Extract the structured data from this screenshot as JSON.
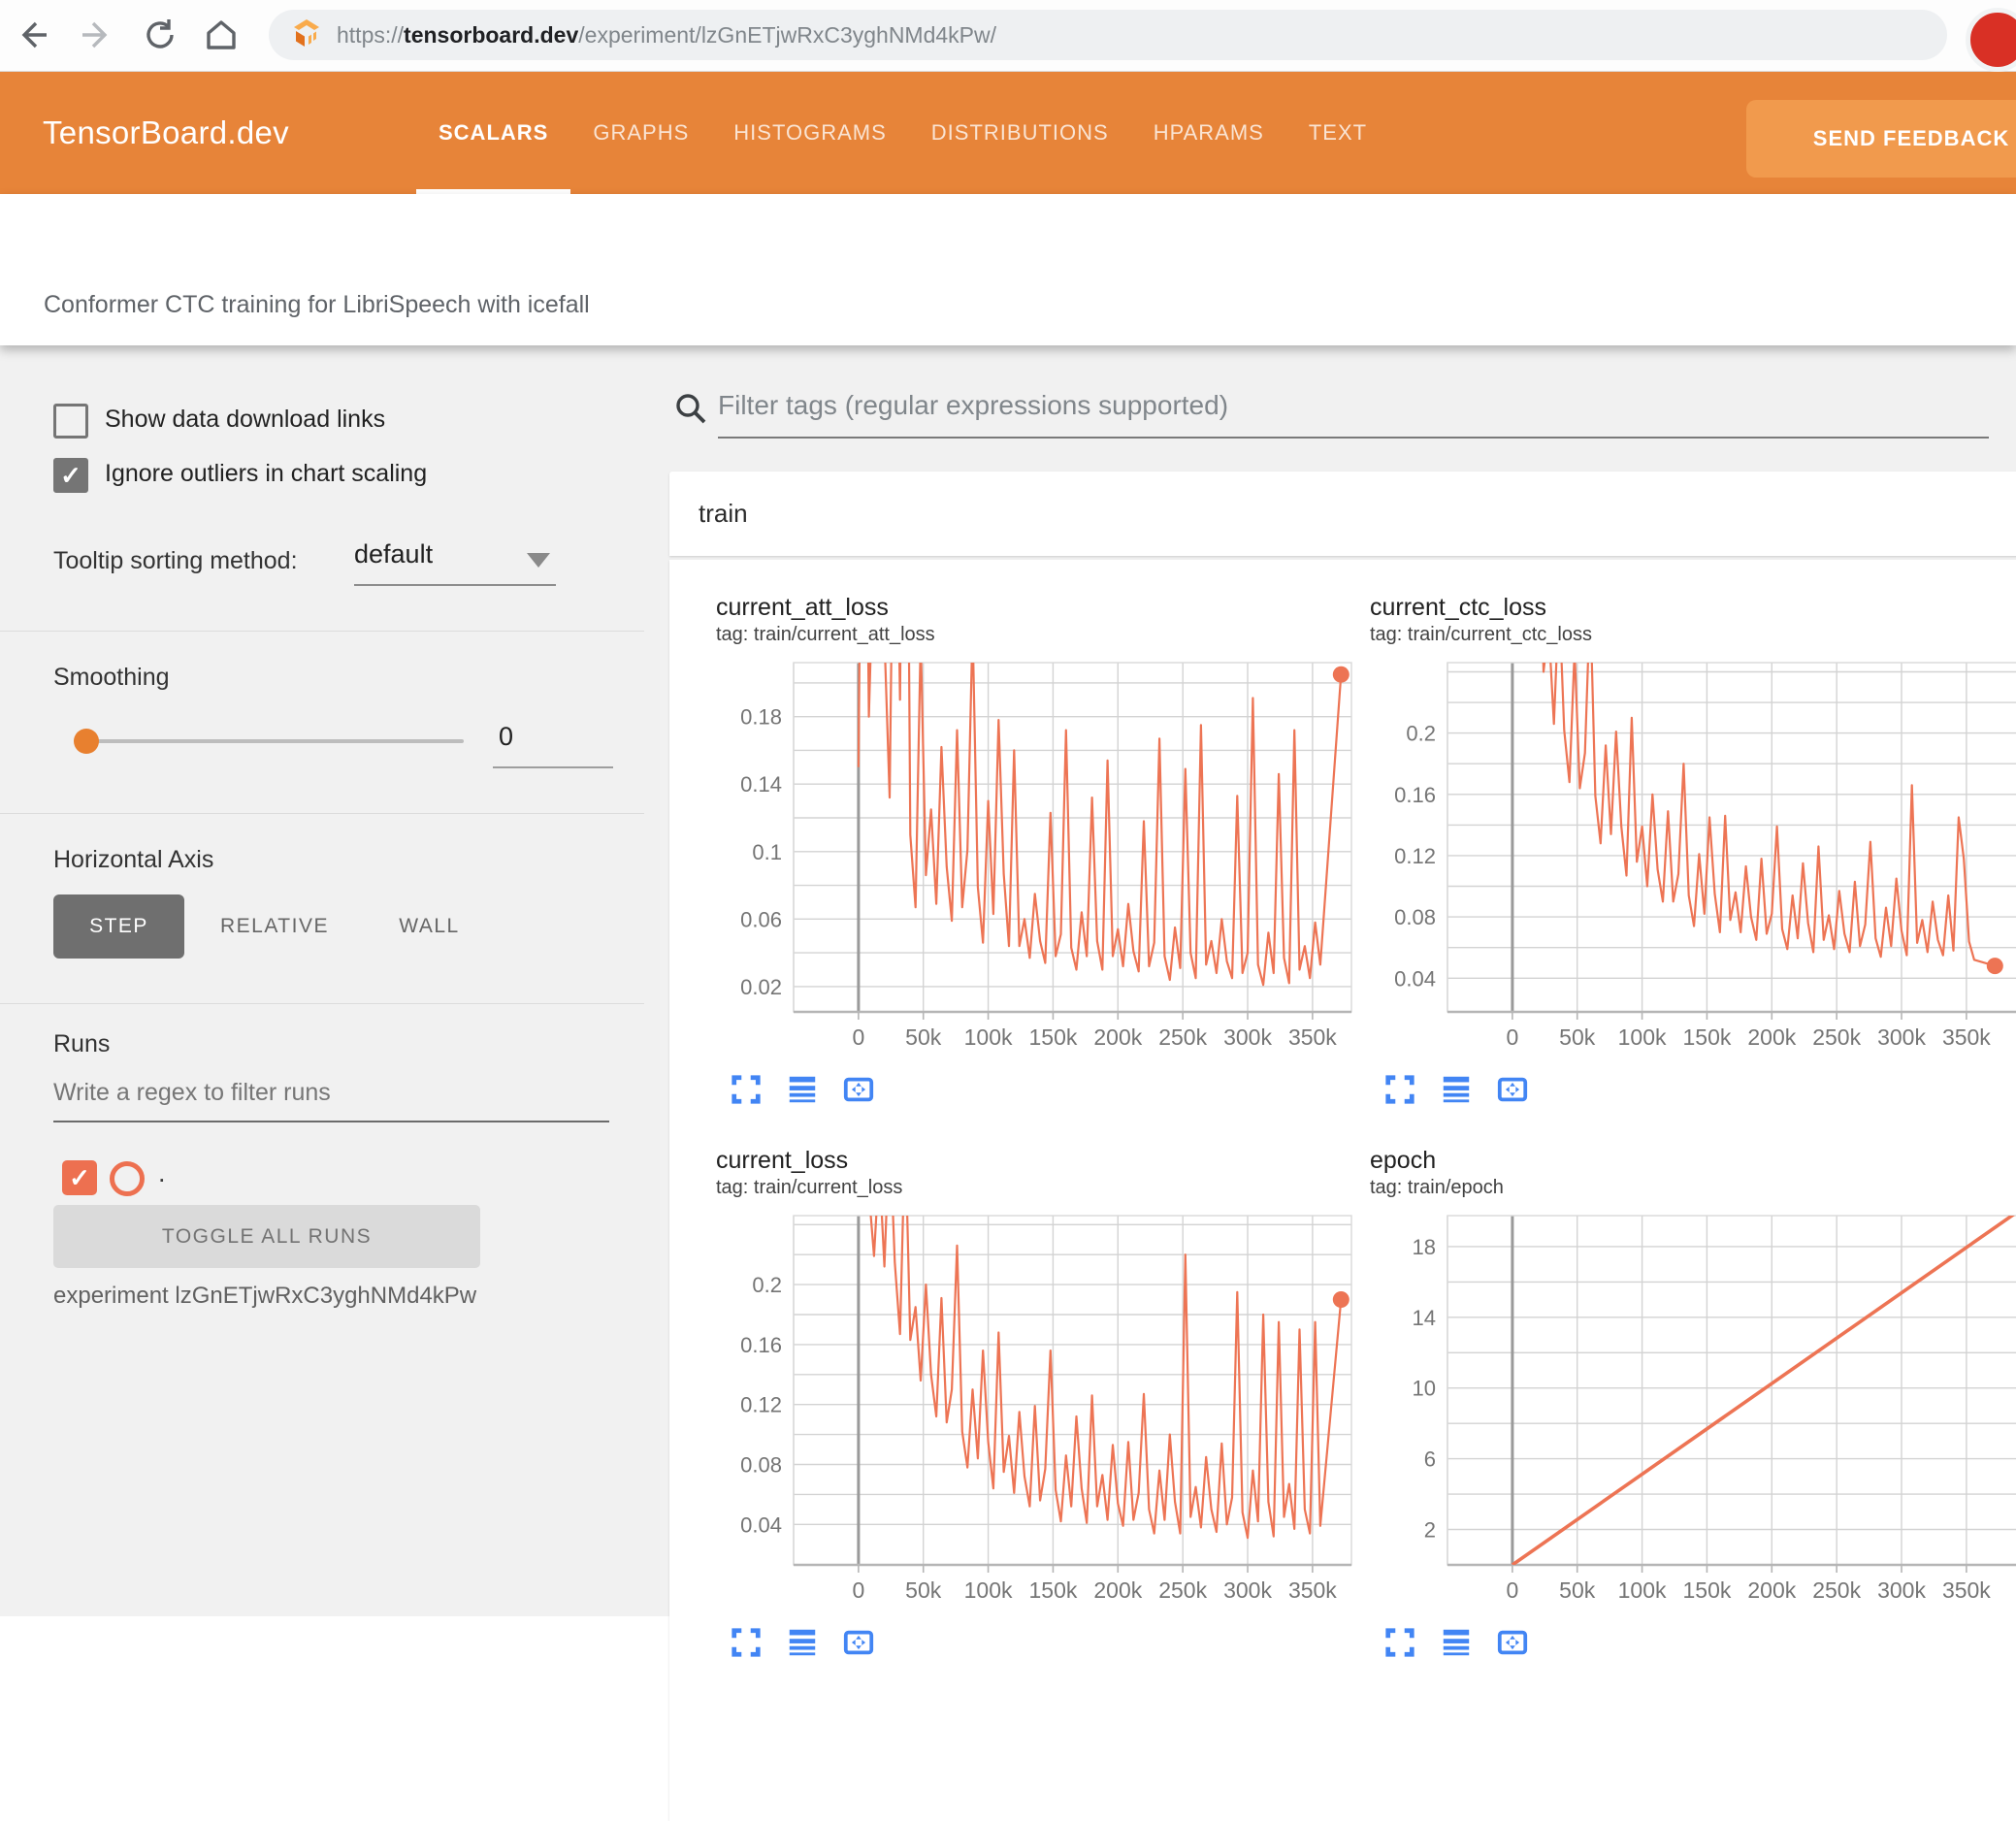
{
  "browser": {
    "url_scheme": "https://",
    "url_domain": "tensorboard.dev",
    "url_path": "/experiment/lzGnETjwRxC3yghNMd4kPw/"
  },
  "header": {
    "brand": "TensorBoard.dev",
    "tabs": [
      {
        "label": "SCALARS",
        "active": true
      },
      {
        "label": "GRAPHS",
        "active": false
      },
      {
        "label": "HISTOGRAMS",
        "active": false
      },
      {
        "label": "DISTRIBUTIONS",
        "active": false
      },
      {
        "label": "HPARAMS",
        "active": false
      },
      {
        "label": "TEXT",
        "active": false
      }
    ],
    "feedback_button": "SEND FEEDBACK"
  },
  "subtitle": "Conformer CTC training for LibriSpeech with icefall",
  "sidebar": {
    "show_download": {
      "label": "Show data download links",
      "checked": false
    },
    "ignore_outliers": {
      "label": "Ignore outliers in chart scaling",
      "checked": true
    },
    "tooltip_sorting": {
      "label": "Tooltip sorting method:",
      "value": "default"
    },
    "smoothing": {
      "label": "Smoothing",
      "value": "0"
    },
    "horizontal_axis": {
      "label": "Horizontal Axis",
      "options": [
        {
          "label": "STEP",
          "active": true
        },
        {
          "label": "RELATIVE",
          "active": false
        },
        {
          "label": "WALL",
          "active": false
        }
      ]
    },
    "runs": {
      "label": "Runs",
      "filter_placeholder": "Write a regex to filter runs",
      "run_name": ".",
      "run_checked": true,
      "toggle_button": "TOGGLE ALL RUNS",
      "experiment_caption": "experiment lzGnETjwRxC3yghNMd4kPw"
    }
  },
  "main": {
    "filter_placeholder": "Filter tags (regular expressions supported)",
    "group_title": "train",
    "card_toolbar_icons": [
      "fullscreen-icon",
      "log-scale-lines-icon",
      "fit-domain-icon"
    ]
  },
  "colors": {
    "header_orange": "#E78439",
    "feedback_orange": "#F19A4D",
    "series_orange": "#ED7454",
    "run_orange": "#ED7050",
    "icon_blue": "#4285F4",
    "avatar_red": "#d93025",
    "grid_gray": "#d3d3d3",
    "axis_gray": "#9a9a9a"
  },
  "chart_data": [
    {
      "type": "line",
      "title": "current_att_loss",
      "tag": "tag: train/current_att_loss",
      "xlabel": "step",
      "legend": "none",
      "grid": true,
      "xlim": [
        -50000,
        380000
      ],
      "ylim": [
        0.005,
        0.212
      ],
      "ygrid": {
        "start": 0.02,
        "step": 0.02,
        "end": 0.2
      },
      "yticks": [
        {
          "v": 0.02,
          "label": "0.02"
        },
        {
          "v": 0.06,
          "label": "0.06"
        },
        {
          "v": 0.1,
          "label": "0.1"
        },
        {
          "v": 0.14,
          "label": "0.14"
        },
        {
          "v": 0.18,
          "label": "0.18"
        }
      ],
      "xticks": [
        {
          "v": 0,
          "label": "0"
        },
        {
          "v": 50000,
          "label": "50k"
        },
        {
          "v": 100000,
          "label": "100k"
        },
        {
          "v": 150000,
          "label": "150k"
        },
        {
          "v": 200000,
          "label": "200k"
        },
        {
          "v": 250000,
          "label": "250k"
        },
        {
          "v": 300000,
          "label": "300k"
        },
        {
          "v": 350000,
          "label": "350k"
        }
      ],
      "x0": 0,
      "dx": 4000,
      "values": [
        0.15,
        0.49,
        0.18,
        0.288,
        0.69,
        0.228,
        0.132,
        0.39,
        0.19,
        0.54,
        0.11,
        0.067,
        0.227,
        0.086,
        0.125,
        0.069,
        0.162,
        0.091,
        0.059,
        0.172,
        0.067,
        0.101,
        0.234,
        0.079,
        0.046,
        0.13,
        0.063,
        0.178,
        0.087,
        0.044,
        0.16,
        0.044,
        0.06,
        0.037,
        0.075,
        0.047,
        0.034,
        0.123,
        0.038,
        0.051,
        0.172,
        0.043,
        0.03,
        0.064,
        0.038,
        0.132,
        0.047,
        0.03,
        0.154,
        0.038,
        0.054,
        0.032,
        0.069,
        0.041,
        0.029,
        0.118,
        0.032,
        0.046,
        0.167,
        0.038,
        0.024,
        0.055,
        0.031,
        0.149,
        0.04,
        0.025,
        0.175,
        0.033,
        0.047,
        0.028,
        0.06,
        0.035,
        0.025,
        0.133,
        0.028,
        0.04,
        0.191,
        0.033,
        0.021,
        0.052,
        0.028,
        0.146,
        0.037,
        0.022,
        0.172,
        0.03,
        0.044,
        0.025,
        0.058,
        0.033
      ],
      "end_dot": {
        "x": 372000,
        "y": 0.205
      }
    },
    {
      "type": "line",
      "title": "current_ctc_loss",
      "tag": "tag: train/current_ctc_loss",
      "xlabel": "step",
      "legend": "none",
      "grid": true,
      "xlim": [
        -50000,
        443000
      ],
      "ylim": [
        0.018,
        0.246
      ],
      "ygrid": {
        "start": 0.04,
        "step": 0.02,
        "end": 0.24
      },
      "yticks": [
        {
          "v": 0.04,
          "label": "0.04"
        },
        {
          "v": 0.08,
          "label": "0.08"
        },
        {
          "v": 0.12,
          "label": "0.12"
        },
        {
          "v": 0.16,
          "label": "0.16"
        },
        {
          "v": 0.2,
          "label": "0.2"
        }
      ],
      "xticks": [
        {
          "v": 0,
          "label": "0"
        },
        {
          "v": 50000,
          "label": "50k"
        },
        {
          "v": 100000,
          "label": "100k"
        },
        {
          "v": 150000,
          "label": "150k"
        },
        {
          "v": 200000,
          "label": "200k"
        },
        {
          "v": 250000,
          "label": "250k"
        },
        {
          "v": 300000,
          "label": "300k"
        },
        {
          "v": 350000,
          "label": "350k"
        }
      ],
      "x0": 0,
      "dx": 4000,
      "values": [
        0.39,
        0.304,
        0.41,
        0.3,
        0.248,
        0.39,
        0.24,
        0.27,
        0.206,
        0.29,
        0.202,
        0.168,
        0.254,
        0.164,
        0.187,
        0.288,
        0.159,
        0.128,
        0.192,
        0.134,
        0.201,
        0.139,
        0.107,
        0.21,
        0.116,
        0.139,
        0.1,
        0.16,
        0.111,
        0.09,
        0.149,
        0.09,
        0.108,
        0.18,
        0.094,
        0.074,
        0.121,
        0.082,
        0.145,
        0.095,
        0.07,
        0.146,
        0.078,
        0.096,
        0.07,
        0.113,
        0.08,
        0.065,
        0.118,
        0.069,
        0.082,
        0.139,
        0.072,
        0.059,
        0.094,
        0.066,
        0.115,
        0.076,
        0.057,
        0.126,
        0.065,
        0.081,
        0.059,
        0.097,
        0.069,
        0.057,
        0.103,
        0.061,
        0.075,
        0.129,
        0.066,
        0.054,
        0.086,
        0.061,
        0.105,
        0.071,
        0.055,
        0.166,
        0.063,
        0.078,
        0.057,
        0.09,
        0.065,
        0.055,
        0.094,
        0.058,
        0.145,
        0.118,
        0.064,
        0.052
      ],
      "end_dot": {
        "x": 372000,
        "y": 0.048
      }
    },
    {
      "type": "line",
      "title": "current_loss",
      "tag": "tag: train/current_loss",
      "xlabel": "step",
      "legend": "none",
      "grid": true,
      "xlim": [
        -50000,
        380000
      ],
      "ylim": [
        0.013,
        0.246
      ],
      "ygrid": {
        "start": 0.04,
        "step": 0.02,
        "end": 0.24
      },
      "yticks": [
        {
          "v": 0.04,
          "label": "0.04"
        },
        {
          "v": 0.08,
          "label": "0.08"
        },
        {
          "v": 0.12,
          "label": "0.12"
        },
        {
          "v": 0.16,
          "label": "0.16"
        },
        {
          "v": 0.2,
          "label": "0.2"
        }
      ],
      "xticks": [
        {
          "v": 0,
          "label": "0"
        },
        {
          "v": 50000,
          "label": "50k"
        },
        {
          "v": 100000,
          "label": "100k"
        },
        {
          "v": 150000,
          "label": "150k"
        },
        {
          "v": 200000,
          "label": "200k"
        },
        {
          "v": 250000,
          "label": "250k"
        },
        {
          "v": 300000,
          "label": "300k"
        },
        {
          "v": 350000,
          "label": "350k"
        }
      ],
      "x0": 0,
      "dx": 4000,
      "values": [
        0.31,
        0.416,
        0.262,
        0.219,
        0.281,
        0.212,
        0.306,
        0.215,
        0.167,
        0.303,
        0.163,
        0.185,
        0.136,
        0.2,
        0.14,
        0.112,
        0.191,
        0.108,
        0.13,
        0.226,
        0.102,
        0.078,
        0.13,
        0.084,
        0.156,
        0.095,
        0.064,
        0.168,
        0.075,
        0.099,
        0.061,
        0.115,
        0.072,
        0.052,
        0.119,
        0.056,
        0.077,
        0.156,
        0.063,
        0.042,
        0.086,
        0.052,
        0.112,
        0.064,
        0.041,
        0.126,
        0.052,
        0.073,
        0.043,
        0.093,
        0.054,
        0.039,
        0.095,
        0.043,
        0.061,
        0.127,
        0.05,
        0.034,
        0.076,
        0.043,
        0.1,
        0.055,
        0.034,
        0.22,
        0.045,
        0.065,
        0.038,
        0.085,
        0.05,
        0.035,
        0.094,
        0.04,
        0.058,
        0.195,
        0.048,
        0.031,
        0.076,
        0.042,
        0.18,
        0.055,
        0.032,
        0.175,
        0.045,
        0.067,
        0.037,
        0.17,
        0.05,
        0.034,
        0.175,
        0.039
      ],
      "end_dot": {
        "x": 372000,
        "y": 0.19
      }
    },
    {
      "type": "line",
      "title": "epoch",
      "tag": "tag: train/epoch",
      "xlabel": "step",
      "legend": "none",
      "grid": true,
      "xlim": [
        -50000,
        443000
      ],
      "ylim": [
        0,
        19.75
      ],
      "ygrid": {
        "start": 2,
        "step": 2,
        "end": 18
      },
      "yticks": [
        {
          "v": 2,
          "label": "2"
        },
        {
          "v": 6,
          "label": "6"
        },
        {
          "v": 10,
          "label": "10"
        },
        {
          "v": 14,
          "label": "14"
        },
        {
          "v": 18,
          "label": "18"
        }
      ],
      "xticks": [
        {
          "v": 0,
          "label": "0"
        },
        {
          "v": 50000,
          "label": "50k"
        },
        {
          "v": 100000,
          "label": "100k"
        },
        {
          "v": 150000,
          "label": "150k"
        },
        {
          "v": 200000,
          "label": "200k"
        },
        {
          "v": 250000,
          "label": "250k"
        },
        {
          "v": 300000,
          "label": "300k"
        },
        {
          "v": 350000,
          "label": "350k"
        }
      ],
      "points": [
        [
          0,
          0
        ],
        [
          390000,
          20
        ]
      ]
    }
  ]
}
